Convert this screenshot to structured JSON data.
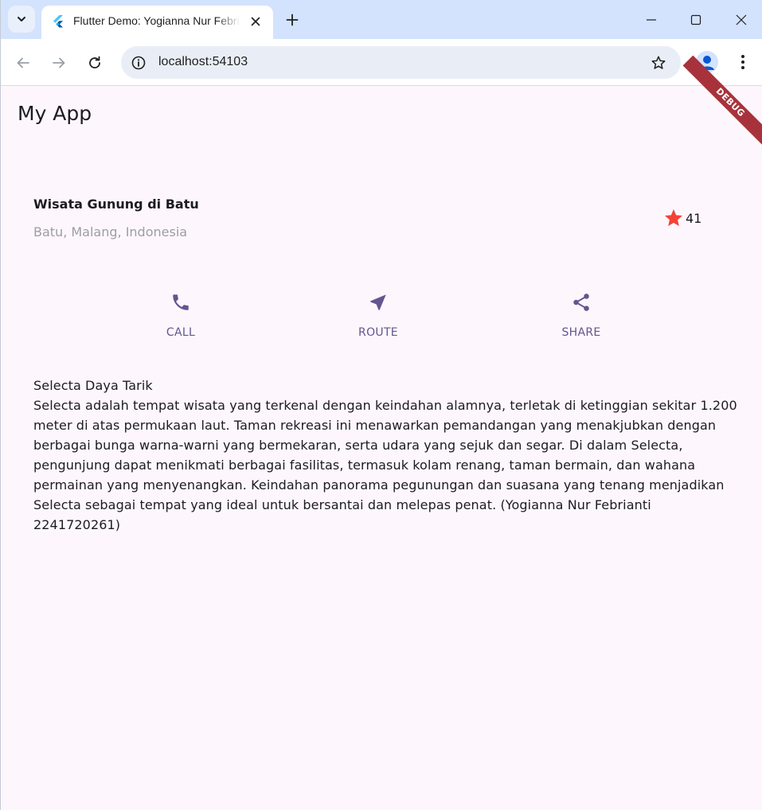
{
  "browser": {
    "tab_title": "Flutter Demo: Yogianna Nur Febrianti",
    "url": "localhost:54103"
  },
  "app": {
    "title": "My App",
    "debug_banner": "DEBUG",
    "place": {
      "title": "Wisata Gunung di Batu",
      "location": "Batu, Malang, Indonesia",
      "rating_count": "41"
    },
    "actions": [
      {
        "label": "CALL",
        "icon": "phone-icon"
      },
      {
        "label": "ROUTE",
        "icon": "near-me-icon"
      },
      {
        "label": "SHARE",
        "icon": "share-icon"
      }
    ],
    "description": {
      "heading": "Selecta Daya Tarik",
      "body": "Selecta adalah tempat wisata yang terkenal dengan keindahan alamnya, terletak di ketinggian sekitar 1.200 meter di atas permukaan laut. Taman rekreasi ini menawarkan pemandangan yang menakjubkan dengan berbagai bunga warna-warni yang bermekaran, serta udara yang sejuk dan segar. Di dalam Selecta, pengunjung dapat menikmati berbagai fasilitas, termasuk kolam renang, taman bermain, dan wahana permainan yang menyenangkan. Keindahan panorama pegunungan dan suasana yang tenang menjadikan Selecta sebagai tempat yang ideal untuk bersantai dan melepas penat. (Yogianna Nur Febrianti 2241720261)"
    }
  },
  "colors": {
    "accent": "#65558f",
    "star": "#f44336",
    "background": "#fdf7fd",
    "debug": "#a8323b"
  }
}
